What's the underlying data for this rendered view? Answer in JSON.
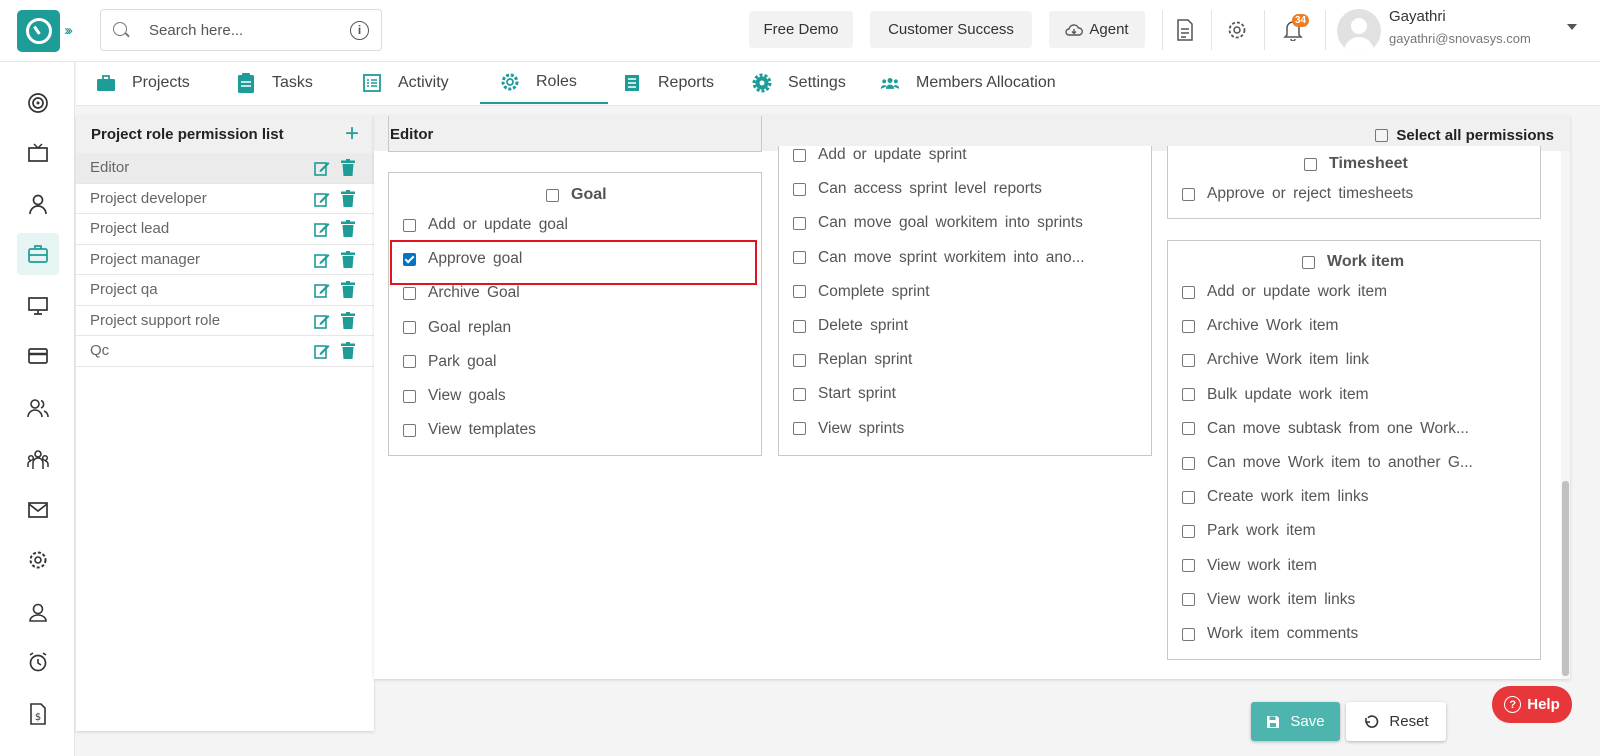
{
  "header": {
    "search_placeholder": "Search here...",
    "free_demo": "Free Demo",
    "customer_success": "Customer Success",
    "agent": "Agent",
    "notifications_count": "34",
    "user_name": "Gayathri",
    "user_email": "gayathri@snovasys.com"
  },
  "tabs": [
    {
      "label": "Projects",
      "icon": "briefcase-icon"
    },
    {
      "label": "Tasks",
      "icon": "clipboard-icon"
    },
    {
      "label": "Activity",
      "icon": "list-icon"
    },
    {
      "label": "Roles",
      "icon": "gear-icon",
      "active": true
    },
    {
      "label": "Reports",
      "icon": "document-icon"
    },
    {
      "label": "Settings",
      "icon": "gear-icon"
    },
    {
      "label": "Members Allocation",
      "icon": "group-icon"
    }
  ],
  "roles_panel": {
    "title": "Project role permission list",
    "roles": [
      "Editor",
      "Project developer",
      "Project lead",
      "Project manager",
      "Project qa",
      "Project support role",
      "Qc"
    ],
    "selected": "Editor"
  },
  "main": {
    "title": "Editor",
    "select_all_label": "Select all permissions",
    "goal": {
      "title": "Goal",
      "items": [
        {
          "label": "Add or update goal",
          "checked": false
        },
        {
          "label": "Approve goal",
          "checked": true
        },
        {
          "label": "Archive Goal",
          "checked": false
        },
        {
          "label": "Goal replan",
          "checked": false
        },
        {
          "label": "Park goal",
          "checked": false
        },
        {
          "label": "View goals",
          "checked": false
        },
        {
          "label": "View templates",
          "checked": false
        }
      ]
    },
    "sprint": {
      "items": [
        {
          "label": "Add or update sprint",
          "checked": false
        },
        {
          "label": "Can access sprint level reports",
          "checked": false
        },
        {
          "label": "Can move goal workitem into sprints",
          "checked": false
        },
        {
          "label": "Can move sprint workitem into ano...",
          "checked": false
        },
        {
          "label": "Complete sprint",
          "checked": false
        },
        {
          "label": "Delete sprint",
          "checked": false
        },
        {
          "label": "Replan sprint",
          "checked": false
        },
        {
          "label": "Start sprint",
          "checked": false
        },
        {
          "label": "View sprints",
          "checked": false
        }
      ]
    },
    "timesheet": {
      "title": "Timesheet",
      "items": [
        {
          "label": "Approve or reject timesheets",
          "checked": false
        }
      ]
    },
    "work_item": {
      "title": "Work item",
      "items": [
        {
          "label": "Add or update work item",
          "checked": false
        },
        {
          "label": "Archive Work item",
          "checked": false
        },
        {
          "label": "Archive Work item link",
          "checked": false
        },
        {
          "label": "Bulk update work item",
          "checked": false
        },
        {
          "label": "Can move subtask from one Work...",
          "checked": false
        },
        {
          "label": "Can move Work item to another G...",
          "checked": false
        },
        {
          "label": "Create work item links",
          "checked": false
        },
        {
          "label": "Park work item",
          "checked": false
        },
        {
          "label": "View work item",
          "checked": false
        },
        {
          "label": "View work item links",
          "checked": false
        },
        {
          "label": "Work item comments",
          "checked": false
        }
      ]
    }
  },
  "footer": {
    "save_label": "Save",
    "reset_label": "Reset",
    "help_label": "Help"
  },
  "colors": {
    "accent": "#1e9c98",
    "highlight": "#e0141e",
    "help": "#e8373a"
  }
}
